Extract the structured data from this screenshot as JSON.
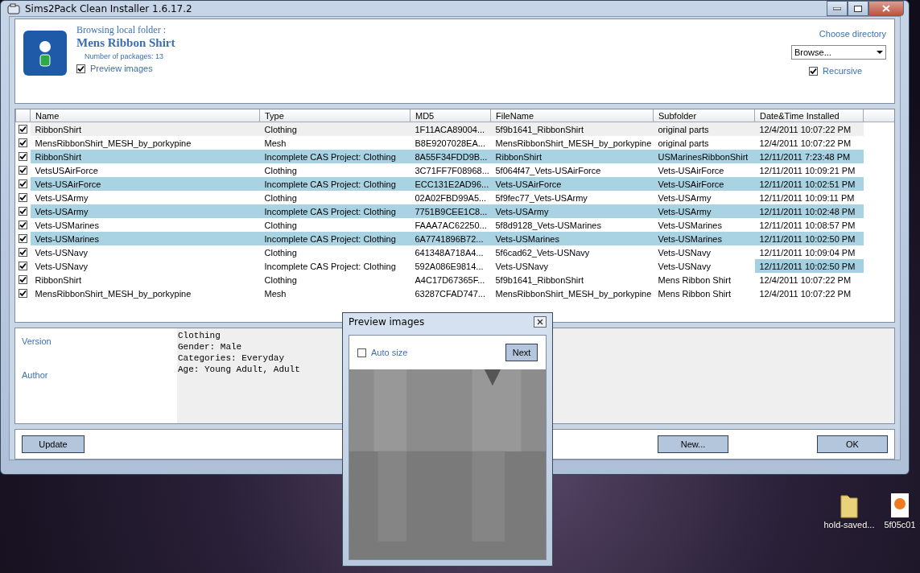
{
  "window": {
    "title": "Sims2Pack Clean Installer 1.6.17.2"
  },
  "header": {
    "browsing_label": "Browsing local folder :",
    "folder_name": "Mens Ribbon Shirt",
    "package_count": "Number of packages: 13",
    "preview_images": {
      "label": "Preview images",
      "checked": true
    },
    "choose_directory": "Choose directory",
    "browse": {
      "value": "Browse..."
    },
    "recursive": {
      "label": "Recursive",
      "checked": true
    }
  },
  "table": {
    "columns": [
      "Name",
      "Type",
      "MD5",
      "FileName",
      "Subfolder",
      "Date&Time Installed"
    ],
    "rows": [
      {
        "checked": true,
        "selected": false,
        "hovered": true,
        "date_selected": false,
        "cells": [
          "RibbonShirt",
          "Clothing",
          "1F11ACA89004...",
          "5f9b1641_RibbonShirt",
          "original parts",
          "12/4/2011 10:07:22 PM"
        ]
      },
      {
        "checked": true,
        "selected": false,
        "hovered": false,
        "date_selected": false,
        "cells": [
          "MensRibbonShirt_MESH_by_porkypine",
          "Mesh",
          "B8E9207028EA...",
          "MensRibbonShirt_MESH_by_porkypine",
          "original parts",
          "12/4/2011 10:07:22 PM"
        ]
      },
      {
        "checked": true,
        "selected": true,
        "hovered": false,
        "date_selected": false,
        "cells": [
          "RibbonShirt",
          "Incomplete CAS Project: Clothing",
          "8A55F34FDD9B...",
          "RibbonShirt",
          "USMarinesRibbonShirt",
          "12/11/2011 7:23:48 PM"
        ]
      },
      {
        "checked": true,
        "selected": false,
        "hovered": false,
        "date_selected": false,
        "cells": [
          "VetsUSAirForce",
          "Clothing",
          "3C71FF7F08968...",
          "5f064f47_Vets-USAirForce",
          "Vets-USAirForce",
          "12/11/2011 10:09:21 PM"
        ]
      },
      {
        "checked": true,
        "selected": true,
        "hovered": false,
        "date_selected": false,
        "cells": [
          "Vets-USAirForce",
          "Incomplete CAS Project: Clothing",
          "ECC131E2AD96...",
          "Vets-USAirForce",
          "Vets-USAirForce",
          "12/11/2011 10:02:51 PM"
        ]
      },
      {
        "checked": true,
        "selected": false,
        "hovered": false,
        "date_selected": false,
        "cells": [
          "Vets-USArmy",
          "Clothing",
          "02A02FBD99A5...",
          "5f9fec77_Vets-USArmy",
          "Vets-USArmy",
          "12/11/2011 10:09:11 PM"
        ]
      },
      {
        "checked": true,
        "selected": true,
        "hovered": false,
        "date_selected": false,
        "cells": [
          "Vets-USArmy",
          "Incomplete CAS Project: Clothing",
          "7751B9CEE1C8...",
          "Vets-USArmy",
          "Vets-USArmy",
          "12/11/2011 10:02:48 PM"
        ]
      },
      {
        "checked": true,
        "selected": false,
        "hovered": false,
        "date_selected": false,
        "cells": [
          "Vets-USMarines",
          "Clothing",
          "FAAA7AC62250...",
          "5f8d9128_Vets-USMarines",
          "Vets-USMarines",
          "12/11/2011 10:08:57 PM"
        ]
      },
      {
        "checked": true,
        "selected": true,
        "hovered": false,
        "date_selected": false,
        "cells": [
          "Vets-USMarines",
          "Incomplete CAS Project: Clothing",
          "6A7741896B72...",
          "Vets-USMarines",
          "Vets-USMarines",
          "12/11/2011 10:02:50 PM"
        ]
      },
      {
        "checked": true,
        "selected": false,
        "hovered": false,
        "date_selected": false,
        "cells": [
          "Vets-USNavy",
          "Clothing",
          "641348A718A4...",
          "5f6cad62_Vets-USNavy",
          "Vets-USNavy",
          "12/11/2011 10:09:04 PM"
        ]
      },
      {
        "checked": true,
        "selected": false,
        "hovered": false,
        "date_selected": true,
        "cells": [
          "Vets-USNavy",
          "Incomplete CAS Project: Clothing",
          "592A086E9814...",
          "Vets-USNavy",
          "Vets-USNavy",
          "12/11/2011 10:02:50 PM"
        ]
      },
      {
        "checked": true,
        "selected": false,
        "hovered": false,
        "date_selected": false,
        "cells": [
          "RibbonShirt",
          "Clothing",
          "A4C17D67365F...",
          "5f9b1641_RibbonShirt",
          "Mens Ribbon Shirt",
          "12/4/2011 10:07:22 PM"
        ]
      },
      {
        "checked": true,
        "selected": false,
        "hovered": false,
        "date_selected": false,
        "cells": [
          "MensRibbonShirt_MESH_by_porkypine",
          "Mesh",
          "63287CFAD747...",
          "MensRibbonShirt_MESH_by_porkypine",
          "Mens Ribbon Shirt",
          "12/4/2011 10:07:22 PM"
        ]
      }
    ]
  },
  "details": {
    "labels": [
      "Version",
      "Author"
    ],
    "description": [
      "Clothing",
      "Gender: Male",
      "Categories: Everyday",
      "Age: Young Adult, Adult"
    ]
  },
  "buttons": {
    "update": "Update",
    "new": "New...",
    "ok": "OK"
  },
  "preview_dialog": {
    "title": "Preview images",
    "auto_size": {
      "label": "Auto size",
      "checked": false
    },
    "next": "Next"
  },
  "desktop_icons": [
    {
      "kind": "folder",
      "label": "hold-saved..."
    },
    {
      "kind": "file",
      "label": "5f05c01"
    }
  ]
}
